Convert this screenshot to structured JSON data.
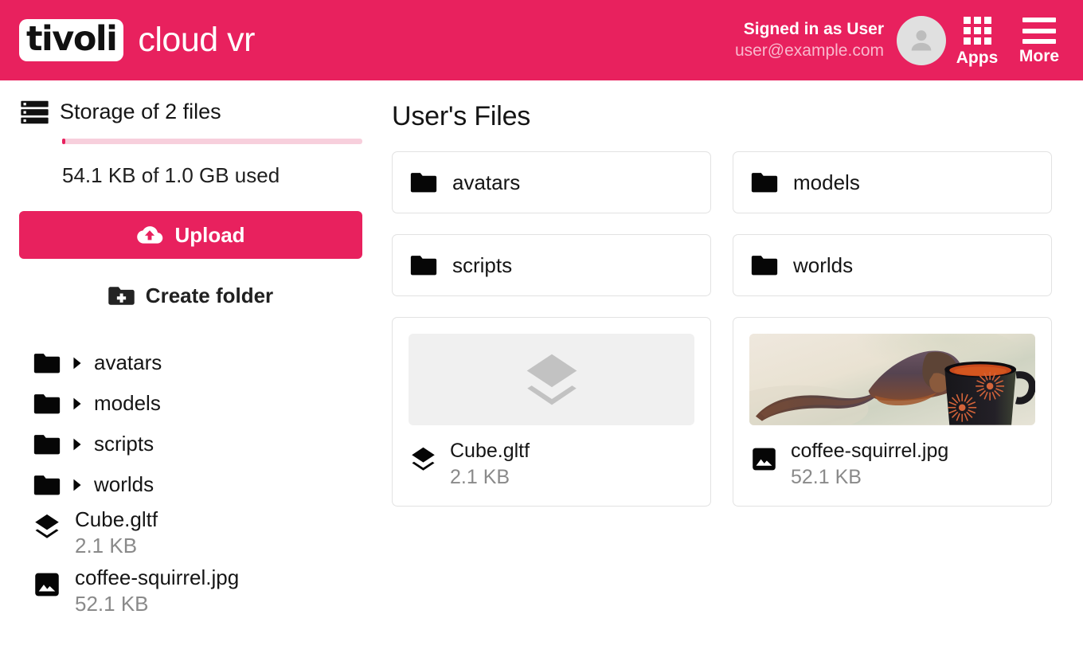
{
  "header": {
    "logo_brand": "tivoli",
    "logo_product": "cloud vr",
    "signed_in_text": "Signed in as User",
    "user_email": "user@example.com",
    "avatar_icon": "person-icon",
    "apps_label": "Apps",
    "apps_icon": "apps-grid-icon",
    "more_label": "More",
    "more_icon": "hamburger-menu-icon",
    "brand_color": "#e8215e"
  },
  "sidebar": {
    "storage_icon": "storage-server-icon",
    "storage_title": "Storage of 2 files",
    "storage_used_text": "54.1 KB of 1.0 GB used",
    "progress_percent": 1,
    "progress_track_color": "#f7cfdc",
    "upload_label": "Upload",
    "upload_icon": "cloud-upload-icon",
    "create_folder_label": "Create folder",
    "create_folder_icon": "folder-plus-icon",
    "tree_folders": [
      {
        "name": "avatars",
        "icon": "folder-icon",
        "caret": "caret-right-icon"
      },
      {
        "name": "models",
        "icon": "folder-icon",
        "caret": "caret-right-icon"
      },
      {
        "name": "scripts",
        "icon": "folder-icon",
        "caret": "caret-right-icon"
      },
      {
        "name": "worlds",
        "icon": "folder-icon",
        "caret": "caret-right-icon"
      }
    ],
    "tree_files": [
      {
        "name": "Cube.gltf",
        "size": "2.1 KB",
        "icon": "layers-icon"
      },
      {
        "name": "coffee-squirrel.jpg",
        "size": "52.1 KB",
        "icon": "image-icon"
      }
    ]
  },
  "main": {
    "title": "User's Files",
    "folders": [
      {
        "name": "avatars",
        "icon": "folder-icon"
      },
      {
        "name": "models",
        "icon": "folder-icon"
      },
      {
        "name": "scripts",
        "icon": "folder-icon"
      },
      {
        "name": "worlds",
        "icon": "folder-icon"
      }
    ],
    "files": [
      {
        "name": "Cube.gltf",
        "size": "2.1 KB",
        "icon": "layers-icon",
        "thumbnail": "placeholder-layers-icon"
      },
      {
        "name": "coffee-squirrel.jpg",
        "size": "52.1 KB",
        "icon": "image-icon",
        "thumbnail": "squirrel-drinking-from-black-mug-photo"
      }
    ]
  }
}
